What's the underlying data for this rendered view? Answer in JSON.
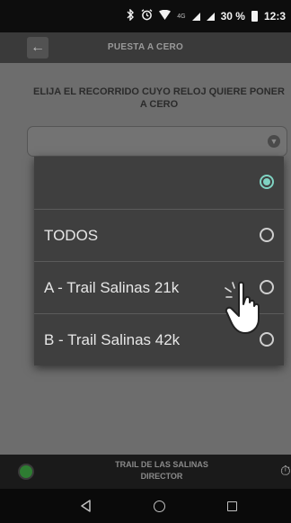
{
  "status_bar": {
    "network_label": "4G",
    "battery_percent": "30 %",
    "time": "12:3",
    "icons": [
      "bluetooth-icon",
      "alarm-icon",
      "wifi-icon",
      "signal-icon",
      "signal-icon",
      "battery-icon"
    ]
  },
  "app_bar": {
    "title": "PUESTA A CERO",
    "back_icon": "arrow-left-icon"
  },
  "main": {
    "prompt": "ELIJA EL RECORRIDO CUYO RELOJ QUIERE PONER A CERO",
    "select": {
      "value": "",
      "icon": "chevron-down-icon"
    }
  },
  "dropdown": {
    "options": [
      {
        "label": "",
        "selected": true
      },
      {
        "label": "TODOS",
        "selected": false
      },
      {
        "label": "A - Trail Salinas 21k",
        "selected": false
      },
      {
        "label": "B - Trail Salinas 42k",
        "selected": false
      }
    ],
    "accent_color": "#7fd3c2"
  },
  "footer": {
    "title_line1": "TRAIL DE LAS SALINAS",
    "title_line2": "DIRECTOR",
    "status_color": "#2e7d32",
    "timer_icon": "stopwatch-icon"
  },
  "nav_bar": {
    "icons": [
      "back-triangle-icon",
      "home-circle-icon",
      "recents-square-icon"
    ]
  }
}
